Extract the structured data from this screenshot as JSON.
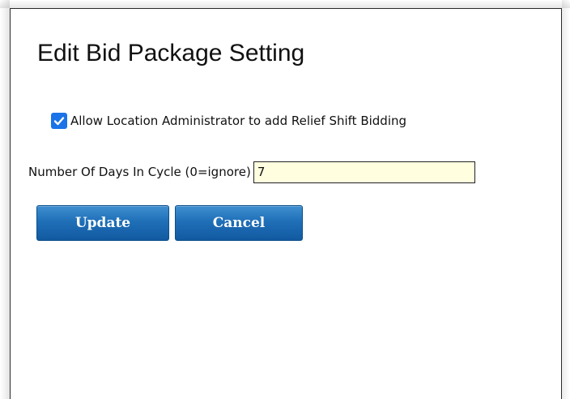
{
  "dialog": {
    "title": "Edit Bid Package Setting",
    "allow_relief": {
      "label": "Allow Location Administrator to add Relief Shift Bidding",
      "checked": true
    },
    "days_in_cycle": {
      "label": "Number Of Days In Cycle (0=ignore)",
      "value": "7"
    },
    "buttons": {
      "update": "Update",
      "cancel": "Cancel"
    }
  },
  "colors": {
    "checkbox": "#1a73e8",
    "input_background": "#ffffe0",
    "button": "#1f6fb8"
  }
}
